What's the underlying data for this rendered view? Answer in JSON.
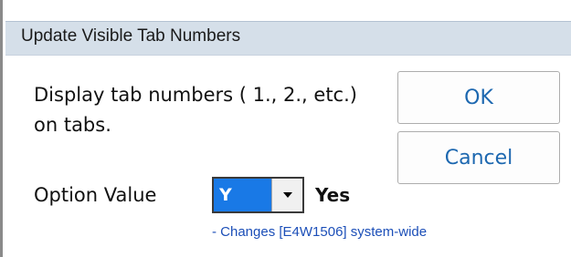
{
  "window": {
    "title": "Update Visible Tab Numbers"
  },
  "message": "Display tab numbers ( 1., 2., etc.) on tabs.",
  "buttons": {
    "ok_label": "OK",
    "cancel_label": "Cancel"
  },
  "option": {
    "label": "Option Value",
    "selected_value": "Y",
    "value_description": "Yes",
    "note": "- Changes [E4W1506] system-wide"
  },
  "colors": {
    "title_bar": "#d5dfe9",
    "button_text": "#1d68b0",
    "select_highlight": "#1979e6",
    "note_text": "#1c4fb8"
  },
  "icons": {
    "dropdown": "chevron-down-icon"
  }
}
